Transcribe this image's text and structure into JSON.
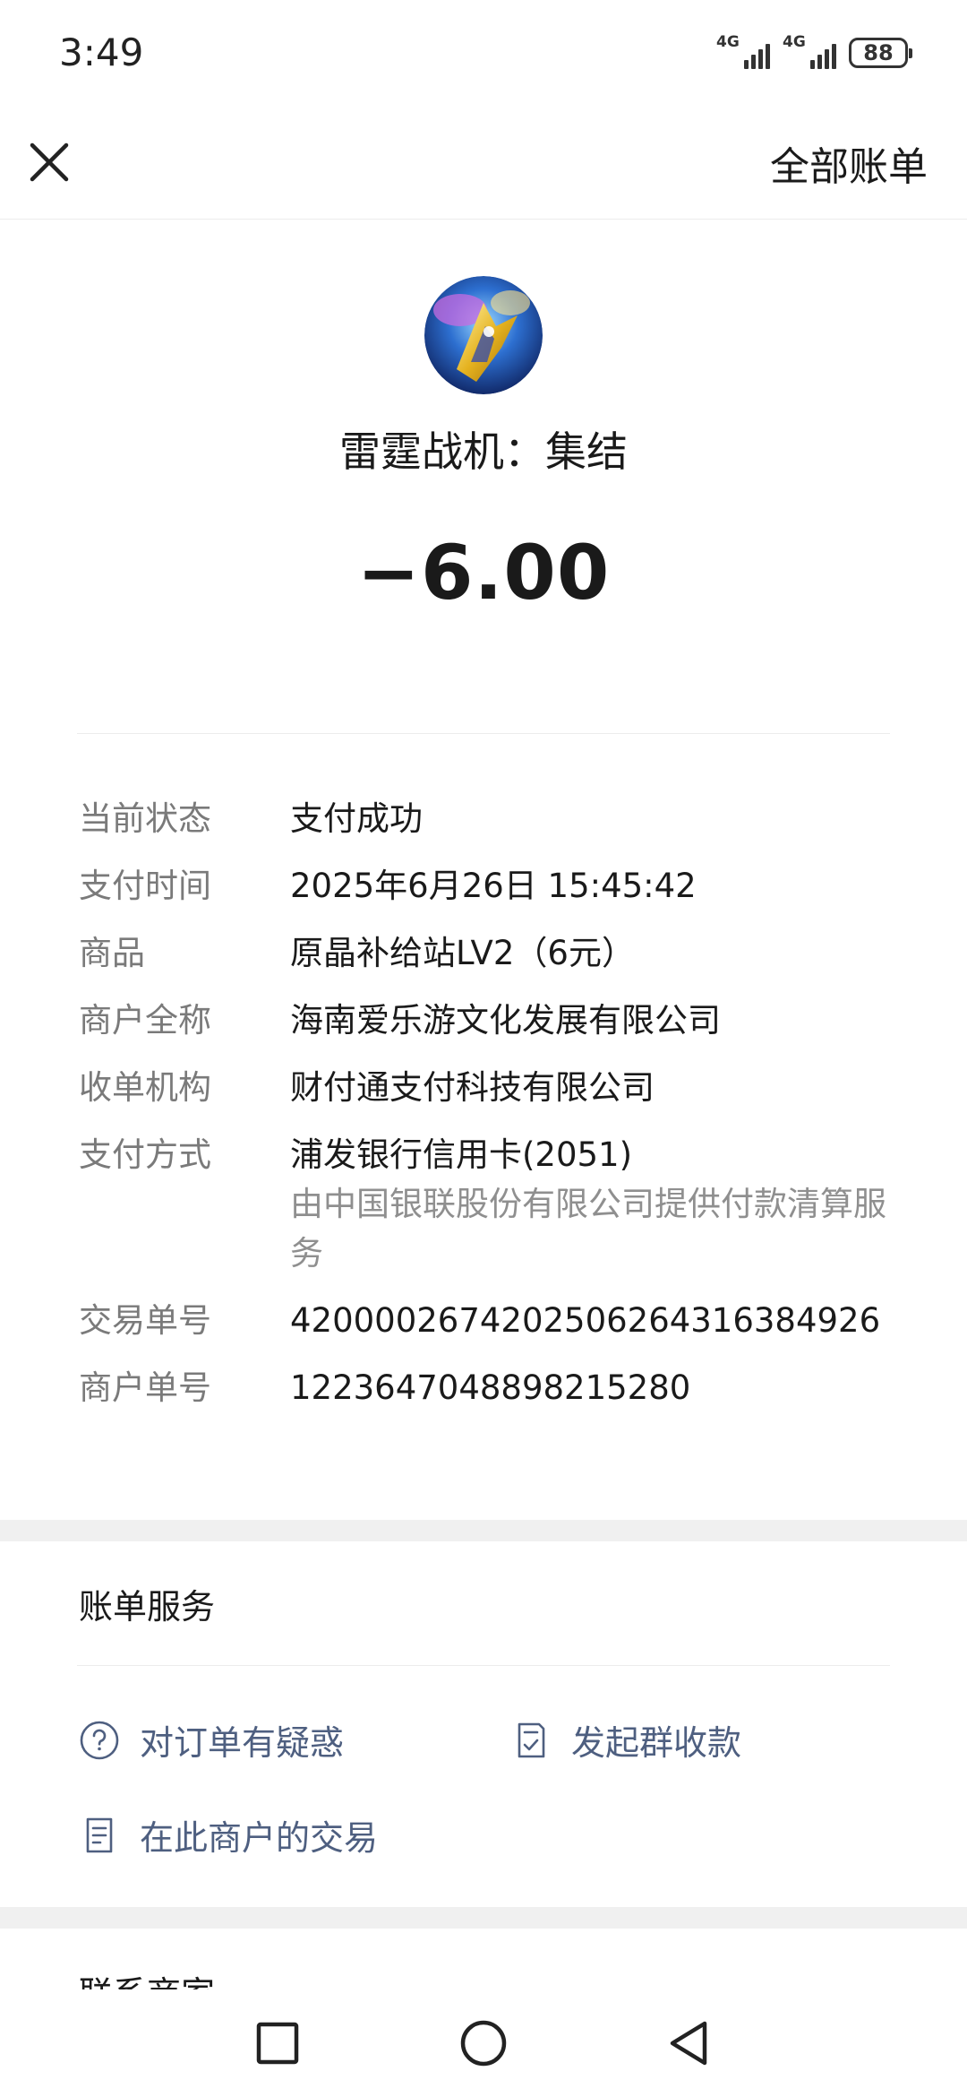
{
  "status_bar": {
    "time": "3:49",
    "network_1": "4G",
    "network_2": "4G",
    "battery": "88"
  },
  "nav": {
    "close_icon": "close-icon",
    "all_bills_label": "全部账单"
  },
  "header": {
    "merchant_logo": "game-logo",
    "merchant_name": "雷霆战机：集结",
    "amount": "−6.00"
  },
  "details": [
    {
      "label": "当前状态",
      "value": "支付成功"
    },
    {
      "label": "支付时间",
      "value": "2025年6月26日 15:45:42"
    },
    {
      "label": "商品",
      "value": "原晶补给站LV2（6元）"
    },
    {
      "label": "商户全称",
      "value": "海南爱乐游文化发展有限公司"
    },
    {
      "label": "收单机构",
      "value": "财付通支付科技有限公司"
    },
    {
      "label": "支付方式",
      "value": "浦发银行信用卡(2051)",
      "note": "由中国银联股份有限公司提供付款清算服务"
    },
    {
      "label": "交易单号",
      "value": "4200002674202506264316384926"
    },
    {
      "label": "商户单号",
      "value": "1223647048898215280"
    }
  ],
  "bill_service": {
    "title": "账单服务",
    "items": [
      {
        "label": "对订单有疑惑",
        "icon": "question-circle-icon"
      },
      {
        "label": "发起群收款",
        "icon": "receipt-check-icon"
      },
      {
        "label": "在此商户的交易",
        "icon": "document-list-icon"
      }
    ]
  },
  "contact_merchant": {
    "title": "联系商家"
  },
  "system_nav": {
    "recents": "recents-square-icon",
    "home": "home-circle-icon",
    "back": "back-triangle-icon"
  },
  "colors": {
    "link": "#4e5f80",
    "label_gray": "#7a7a7a",
    "band_gray": "#f0f0f0"
  }
}
